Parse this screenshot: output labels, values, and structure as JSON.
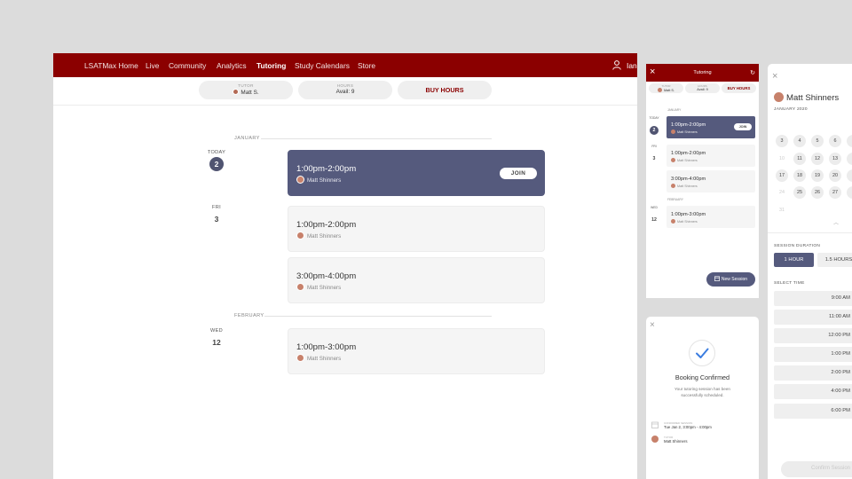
{
  "nav": {
    "items": [
      "LSATMax Home",
      "Live",
      "Community",
      "Analytics",
      "Tutoring",
      "Study Calendars",
      "Store"
    ],
    "active": "Tutoring",
    "user": "Ian"
  },
  "subbar": {
    "tutor_label": "TUTOR",
    "tutor_value": "Matt S.",
    "hours_label": "HOURS",
    "hours_value": "Avail: 9",
    "buy": "BUY HOURS"
  },
  "schedule": {
    "months": [
      "JANUARY",
      "FEBRUARY"
    ],
    "days": [
      {
        "name": "TODAY",
        "num": "2"
      },
      {
        "name": "FRI",
        "num": "3"
      },
      {
        "name": "WED",
        "num": "12"
      }
    ],
    "sessions": [
      {
        "time": "1:00pm-2:00pm",
        "tutor": "Matt Shinners",
        "join": "JOIN"
      },
      {
        "time": "1:00pm-2:00pm",
        "tutor": "Matt Shinners"
      },
      {
        "time": "3:00pm-4:00pm",
        "tutor": "Matt Shinners"
      },
      {
        "time": "1:00pm-3:00pm",
        "tutor": "Matt Shinners"
      }
    ]
  },
  "mobile": {
    "title": "Tutoring",
    "tutor_label": "TUTOR",
    "tutor_value": "Matt S.",
    "hours_label": "HOURS",
    "hours_value": "Avail: 9",
    "buy": "BUY HOURS",
    "months": [
      "JANUARY",
      "FEBRUARY"
    ],
    "days": [
      {
        "name": "TODAY",
        "num": "2"
      },
      {
        "name": "FRI",
        "num": "3"
      },
      {
        "name": "WED",
        "num": "12"
      }
    ],
    "sessions": [
      {
        "time": "1:00pm-2:00pm",
        "tutor": "Matt Shinners",
        "join": "JOIN"
      },
      {
        "time": "1:00pm-2:00pm",
        "tutor": "Matt Shinners"
      },
      {
        "time": "3:00pm-4:00pm",
        "tutor": "Matt Shinners"
      },
      {
        "time": "1:00pm-3:00pm",
        "tutor": "Matt Shinners"
      }
    ],
    "new_session": "New Session"
  },
  "confirmation": {
    "title": "Booking Confirmed",
    "message": "Your tutoring session has been successfully scheduled.",
    "session_label": "CONFIRMED SESSION",
    "session_value": "Tue Jan 2, 3:00pm - 4:00pm",
    "tutor_label": "TUTOR",
    "tutor_value": "Matt Shinners"
  },
  "booking": {
    "tutor": "Matt Shinners",
    "month": "JANUARY 2020",
    "calendar_rows": [
      [
        "3",
        "4",
        "5",
        "6"
      ],
      [
        "10",
        "11",
        "12",
        "13"
      ],
      [
        "17",
        "18",
        "19",
        "20"
      ],
      [
        "24",
        "25",
        "26",
        "27"
      ],
      [
        "31"
      ]
    ],
    "duration_label": "SESSION DURATION",
    "durations": [
      "1 HOUR",
      "1.5 HOURS"
    ],
    "time_label": "SELECT TIME",
    "times": [
      "9:00 AM",
      "11:00 AM",
      "12:00 PM",
      "1:00 PM",
      "2:00 PM",
      "4:00 PM",
      "6:00 PM"
    ],
    "confirm": "Confirm Session"
  },
  "colors": {
    "brand": "#8b0000",
    "accent": "#555a7d"
  }
}
